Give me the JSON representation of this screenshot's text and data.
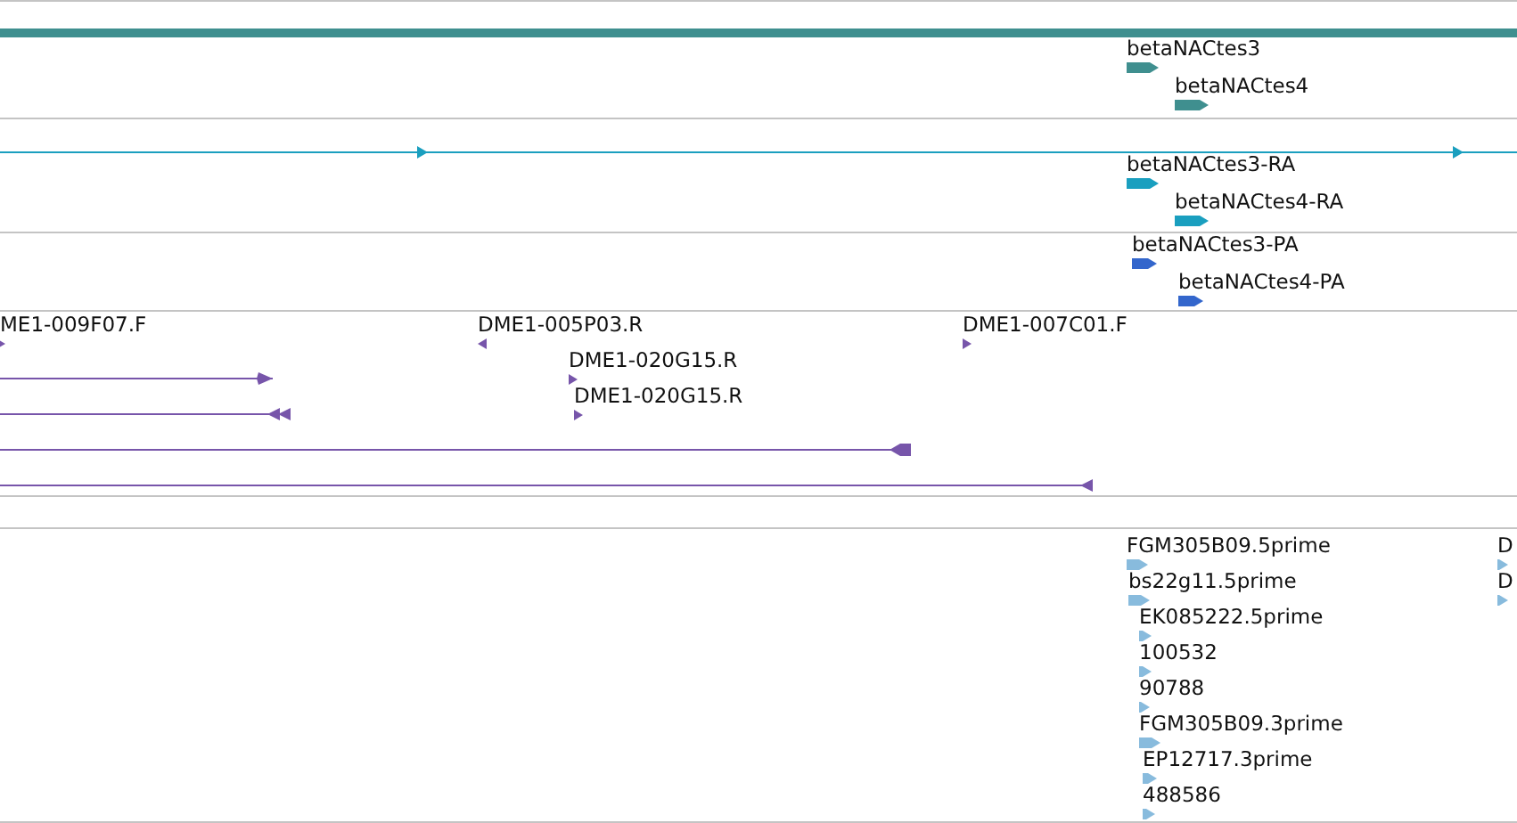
{
  "tracks": [
    {
      "features": [
        {
          "label": "betaNACtes3",
          "reverse": false
        },
        {
          "label": "betaNACtes4",
          "reverse": false
        }
      ]
    },
    {
      "features": [
        {
          "label": "betaNACtes3-RA",
          "reverse": false
        },
        {
          "label": "betaNACtes4-RA",
          "reverse": false
        }
      ]
    },
    {
      "features": [
        {
          "label": "betaNACtes3-PA",
          "reverse": false
        },
        {
          "label": "betaNACtes4-PA",
          "reverse": false
        }
      ]
    },
    {
      "features": [
        {
          "label": "ME1-009F07.F",
          "reverse": false
        },
        {
          "label": "DME1-005P03.R",
          "reverse": true
        },
        {
          "label": "DME1-007C01.F",
          "reverse": false
        },
        {
          "label": "DME1-020G15.R",
          "reverse": false
        },
        {
          "label": "DME1-020G15.R",
          "reverse": false
        }
      ]
    },
    {
      "features": [
        {
          "label": "FGM305B09.5prime",
          "reverse": false
        },
        {
          "label": "bs22g11.5prime",
          "reverse": false
        },
        {
          "label": "EK085222.5prime",
          "reverse": false
        },
        {
          "label": "100532",
          "reverse": false
        },
        {
          "label": "90788",
          "reverse": false
        },
        {
          "label": "FGM305B09.3prime",
          "reverse": false
        },
        {
          "label": "EP12717.3prime",
          "reverse": false
        },
        {
          "label": "488586",
          "reverse": false
        },
        {
          "label": "D",
          "reverse": false
        },
        {
          "label": "D",
          "reverse": false
        }
      ]
    }
  ]
}
